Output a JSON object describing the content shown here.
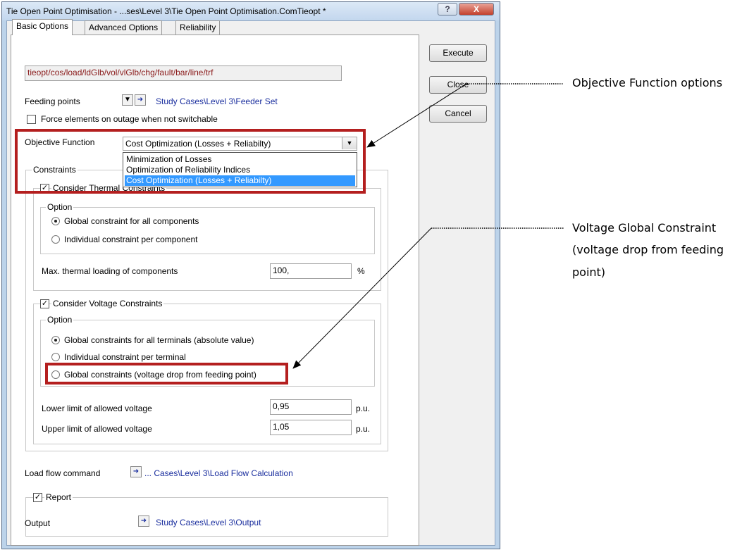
{
  "window": {
    "title": "Tie Open Point Optimisation - ...ses\\Level 3\\Tie Open Point Optimisation.ComTieopt *",
    "help_glyph": "?",
    "close_glyph": "X"
  },
  "tabs": [
    "Basic Options",
    "Advanced Options",
    "Reliability"
  ],
  "buttons": {
    "execute": "Execute",
    "close": "Close",
    "cancel": "Cancel"
  },
  "command_line": "tieopt/cos/load/ldGlb/vol/vlGlb/chg/fault/bar/line/trf",
  "feeding": {
    "label": "Feeding points",
    "value": "Study Cases\\Level 3\\Feeder Set",
    "force_label": "Force elements on outage when not switchable",
    "force_checked": false
  },
  "objective": {
    "label": "Objective Function",
    "selected": "Cost Optimization (Losses + Reliabilty)",
    "options": [
      "Minimization of Losses",
      "Optimization of Reliability Indices",
      "Cost Optimization (Losses + Reliabilty)"
    ]
  },
  "constraints": {
    "title": "Constraints",
    "thermal": {
      "title": "Consider Thermal Constraints",
      "checked": true,
      "option_title": "Option",
      "opt1": "Global constraint for all components",
      "opt2": "Individual constraint per component",
      "max_label": "Max. thermal loading of components",
      "max_value": "100,",
      "max_unit": "%"
    },
    "voltage": {
      "title": "Consider Voltage Constraints",
      "checked": true,
      "option_title": "Option",
      "opt1": "Global constraints for all terminals (absolute value)",
      "opt2": "Individual constraint per terminal",
      "opt3": "Global constraints (voltage drop from feeding point)",
      "lower_label": "Lower limit of allowed voltage",
      "lower_value": "0,95",
      "upper_label": "Upper limit of allowed voltage",
      "upper_value": "1,05",
      "unit": "p.u."
    }
  },
  "loadflow": {
    "label": "Load flow command",
    "value": "... Cases\\Level 3\\Load Flow Calculation"
  },
  "report": {
    "title": "Report",
    "checked": true,
    "output_label": "Output",
    "output_value": "Study Cases\\Level 3\\Output"
  },
  "annotations": {
    "objective": "Objective Function options",
    "voltage_line1": "Voltage Global Constraint",
    "voltage_line2": "(voltage drop from feeding",
    "voltage_line3": "point)"
  },
  "colors": {
    "highlight": "#b41f1f",
    "link": "#1a2e9e",
    "selection": "#3399ff"
  }
}
